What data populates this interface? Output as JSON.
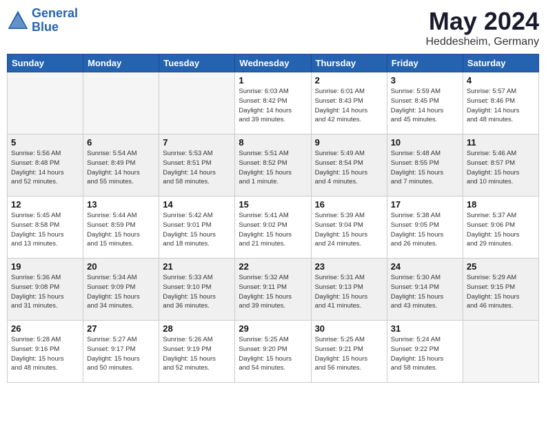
{
  "logo": {
    "line1": "General",
    "line2": "Blue"
  },
  "title": "May 2024",
  "location": "Heddesheim, Germany",
  "days": [
    "Sunday",
    "Monday",
    "Tuesday",
    "Wednesday",
    "Thursday",
    "Friday",
    "Saturday"
  ],
  "weeks": [
    [
      {
        "day": "",
        "info": ""
      },
      {
        "day": "",
        "info": ""
      },
      {
        "day": "",
        "info": ""
      },
      {
        "day": "1",
        "info": "Sunrise: 6:03 AM\nSunset: 8:42 PM\nDaylight: 14 hours\nand 39 minutes."
      },
      {
        "day": "2",
        "info": "Sunrise: 6:01 AM\nSunset: 8:43 PM\nDaylight: 14 hours\nand 42 minutes."
      },
      {
        "day": "3",
        "info": "Sunrise: 5:59 AM\nSunset: 8:45 PM\nDaylight: 14 hours\nand 45 minutes."
      },
      {
        "day": "4",
        "info": "Sunrise: 5:57 AM\nSunset: 8:46 PM\nDaylight: 14 hours\nand 48 minutes."
      }
    ],
    [
      {
        "day": "5",
        "info": "Sunrise: 5:56 AM\nSunset: 8:48 PM\nDaylight: 14 hours\nand 52 minutes."
      },
      {
        "day": "6",
        "info": "Sunrise: 5:54 AM\nSunset: 8:49 PM\nDaylight: 14 hours\nand 55 minutes."
      },
      {
        "day": "7",
        "info": "Sunrise: 5:53 AM\nSunset: 8:51 PM\nDaylight: 14 hours\nand 58 minutes."
      },
      {
        "day": "8",
        "info": "Sunrise: 5:51 AM\nSunset: 8:52 PM\nDaylight: 15 hours\nand 1 minute."
      },
      {
        "day": "9",
        "info": "Sunrise: 5:49 AM\nSunset: 8:54 PM\nDaylight: 15 hours\nand 4 minutes."
      },
      {
        "day": "10",
        "info": "Sunrise: 5:48 AM\nSunset: 8:55 PM\nDaylight: 15 hours\nand 7 minutes."
      },
      {
        "day": "11",
        "info": "Sunrise: 5:46 AM\nSunset: 8:57 PM\nDaylight: 15 hours\nand 10 minutes."
      }
    ],
    [
      {
        "day": "12",
        "info": "Sunrise: 5:45 AM\nSunset: 8:58 PM\nDaylight: 15 hours\nand 13 minutes."
      },
      {
        "day": "13",
        "info": "Sunrise: 5:44 AM\nSunset: 8:59 PM\nDaylight: 15 hours\nand 15 minutes."
      },
      {
        "day": "14",
        "info": "Sunrise: 5:42 AM\nSunset: 9:01 PM\nDaylight: 15 hours\nand 18 minutes."
      },
      {
        "day": "15",
        "info": "Sunrise: 5:41 AM\nSunset: 9:02 PM\nDaylight: 15 hours\nand 21 minutes."
      },
      {
        "day": "16",
        "info": "Sunrise: 5:39 AM\nSunset: 9:04 PM\nDaylight: 15 hours\nand 24 minutes."
      },
      {
        "day": "17",
        "info": "Sunrise: 5:38 AM\nSunset: 9:05 PM\nDaylight: 15 hours\nand 26 minutes."
      },
      {
        "day": "18",
        "info": "Sunrise: 5:37 AM\nSunset: 9:06 PM\nDaylight: 15 hours\nand 29 minutes."
      }
    ],
    [
      {
        "day": "19",
        "info": "Sunrise: 5:36 AM\nSunset: 9:08 PM\nDaylight: 15 hours\nand 31 minutes."
      },
      {
        "day": "20",
        "info": "Sunrise: 5:34 AM\nSunset: 9:09 PM\nDaylight: 15 hours\nand 34 minutes."
      },
      {
        "day": "21",
        "info": "Sunrise: 5:33 AM\nSunset: 9:10 PM\nDaylight: 15 hours\nand 36 minutes."
      },
      {
        "day": "22",
        "info": "Sunrise: 5:32 AM\nSunset: 9:11 PM\nDaylight: 15 hours\nand 39 minutes."
      },
      {
        "day": "23",
        "info": "Sunrise: 5:31 AM\nSunset: 9:13 PM\nDaylight: 15 hours\nand 41 minutes."
      },
      {
        "day": "24",
        "info": "Sunrise: 5:30 AM\nSunset: 9:14 PM\nDaylight: 15 hours\nand 43 minutes."
      },
      {
        "day": "25",
        "info": "Sunrise: 5:29 AM\nSunset: 9:15 PM\nDaylight: 15 hours\nand 46 minutes."
      }
    ],
    [
      {
        "day": "26",
        "info": "Sunrise: 5:28 AM\nSunset: 9:16 PM\nDaylight: 15 hours\nand 48 minutes."
      },
      {
        "day": "27",
        "info": "Sunrise: 5:27 AM\nSunset: 9:17 PM\nDaylight: 15 hours\nand 50 minutes."
      },
      {
        "day": "28",
        "info": "Sunrise: 5:26 AM\nSunset: 9:19 PM\nDaylight: 15 hours\nand 52 minutes."
      },
      {
        "day": "29",
        "info": "Sunrise: 5:25 AM\nSunset: 9:20 PM\nDaylight: 15 hours\nand 54 minutes."
      },
      {
        "day": "30",
        "info": "Sunrise: 5:25 AM\nSunset: 9:21 PM\nDaylight: 15 hours\nand 56 minutes."
      },
      {
        "day": "31",
        "info": "Sunrise: 5:24 AM\nSunset: 9:22 PM\nDaylight: 15 hours\nand 58 minutes."
      },
      {
        "day": "",
        "info": ""
      }
    ]
  ]
}
